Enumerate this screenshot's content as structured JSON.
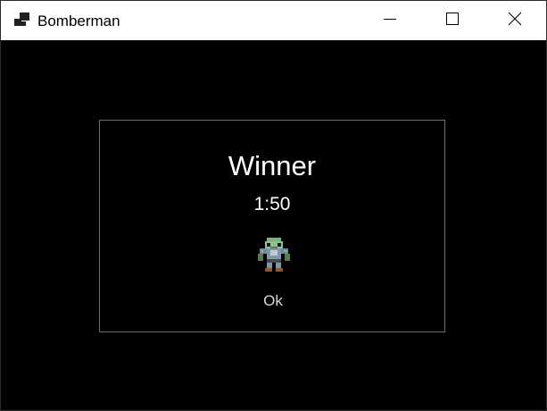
{
  "window": {
    "title": "Bomberman",
    "icon": "app-window-icon",
    "controls": {
      "minimize_icon": "minimize-icon",
      "maximize_icon": "maximize-icon",
      "close_icon": "close-icon"
    }
  },
  "winner_dialog": {
    "title": "Winner",
    "time": "1:50",
    "player_sprite": "player-sprite-icon",
    "ok_label": "Ok"
  },
  "colors": {
    "background": "#000000",
    "titlebar": "#ffffff",
    "panel_border": "#6e6e6e",
    "text": "#ffffff",
    "button_text": "#d8d8d8"
  }
}
